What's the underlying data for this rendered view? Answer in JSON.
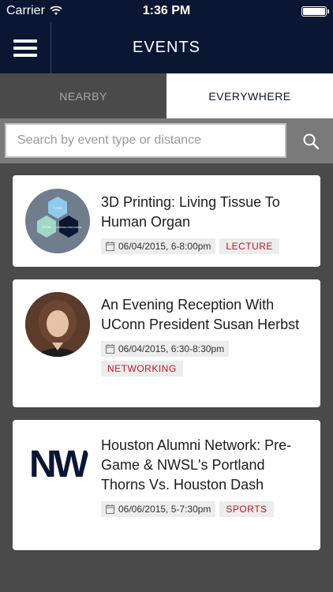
{
  "status_bar": {
    "carrier": "Carrier",
    "time": "1:36 PM"
  },
  "header": {
    "title": "EVENTS"
  },
  "tabs": [
    {
      "label": "NEARBY",
      "active": false
    },
    {
      "label": "EVERYWHERE",
      "active": true
    }
  ],
  "search": {
    "placeholder": "Search by event type or distance"
  },
  "events": [
    {
      "title": "3D Printing: Living Tissue To Human Organ",
      "date": "06/04/2015, 6-8:00pm",
      "tag": "LECTURE",
      "thumb_labels": [
        "FOOD",
        "DRINK",
        "SPIRITED DISCOURSE"
      ]
    },
    {
      "title": "An Evening Reception With UConn President Susan Herbst",
      "date": "06/04/2015, 6:30-8:30pm",
      "tag": "NETWORKING"
    },
    {
      "title": "Houston Alumni Network: Pre-Game & NWSL's Portland Thorns Vs. Houston Dash",
      "date": "06/06/2015, 5-7:30pm",
      "tag": "SPORTS",
      "thumb_logo": "NW"
    }
  ],
  "colors": {
    "navy": "#0b1633",
    "tag_red": "#c4161c"
  }
}
